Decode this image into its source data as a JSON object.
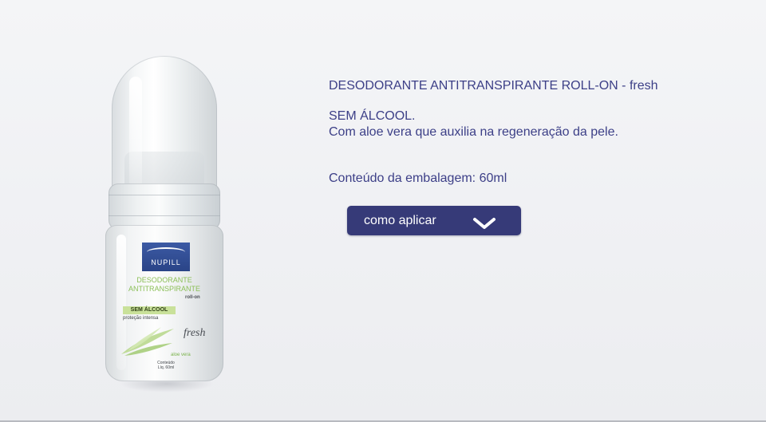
{
  "product": {
    "title": "DESODORANTE ANTITRANSPIRANTE ROLL-ON - fresh",
    "feature_1": "SEM ÁLCOOL.",
    "feature_2": "Com aloe vera que auxilia na regeneração da pele.",
    "content_line": "Conteúdo da embalagem: 60ml"
  },
  "how_to": {
    "label": "como aplicar",
    "icon": "chevron-down-icon"
  },
  "bottle_label": {
    "brand": "NUPILL",
    "line_1": "DESODORANTE",
    "line_2": "ANTITRANSPIRANTE",
    "type": "roll-on",
    "band": "SEM ÁLCOOL",
    "sub": "proteção intensa",
    "variant": "fresh",
    "aloe": "aloe vera",
    "contents_1": "Conteúdo",
    "contents_2": "Líq. 60ml"
  },
  "colors": {
    "text_accent": "#3c3f87",
    "button_bg": "#363a78",
    "button_text": "#ffffff",
    "label_green": "#8bbf57",
    "brand_blue": "#2a4487"
  }
}
